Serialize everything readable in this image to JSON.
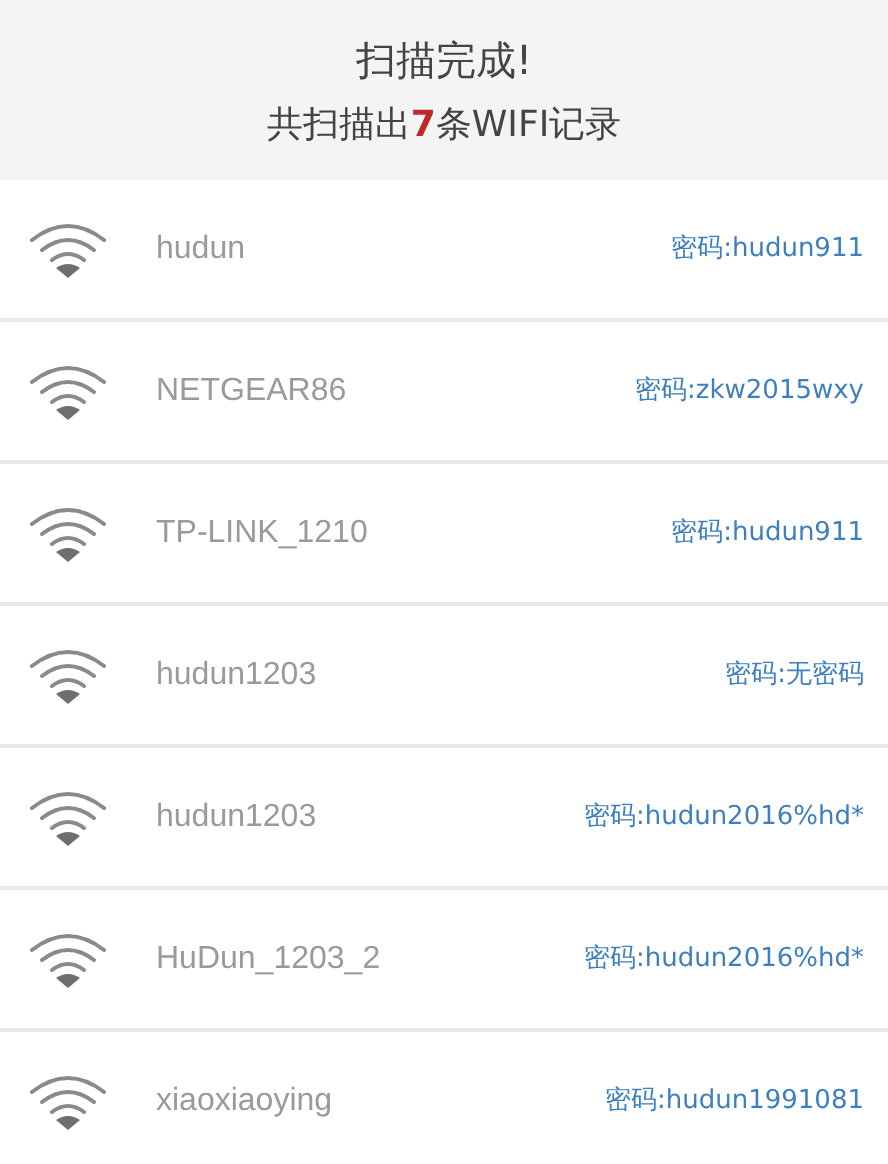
{
  "header": {
    "title": "扫描完成!",
    "summary": {
      "prefix": "共扫描出",
      "count": "7",
      "suffix": "条WIFI记录"
    }
  },
  "networks": [
    {
      "ssid": "hudun",
      "password": "密码:hudun911"
    },
    {
      "ssid": "NETGEAR86",
      "password": "密码:zkw2015wxy"
    },
    {
      "ssid": "TP-LINK_1210",
      "password": "密码:hudun911"
    },
    {
      "ssid": "hudun1203",
      "password": "密码:无密码"
    },
    {
      "ssid": "hudun1203",
      "password": "密码:hudun2016%hd*"
    },
    {
      "ssid": "HuDun_1203_2",
      "password": "密码:hudun2016%hd*"
    },
    {
      "ssid": "xiaoxiaoying",
      "password": "密码:hudun1991081"
    }
  ]
}
